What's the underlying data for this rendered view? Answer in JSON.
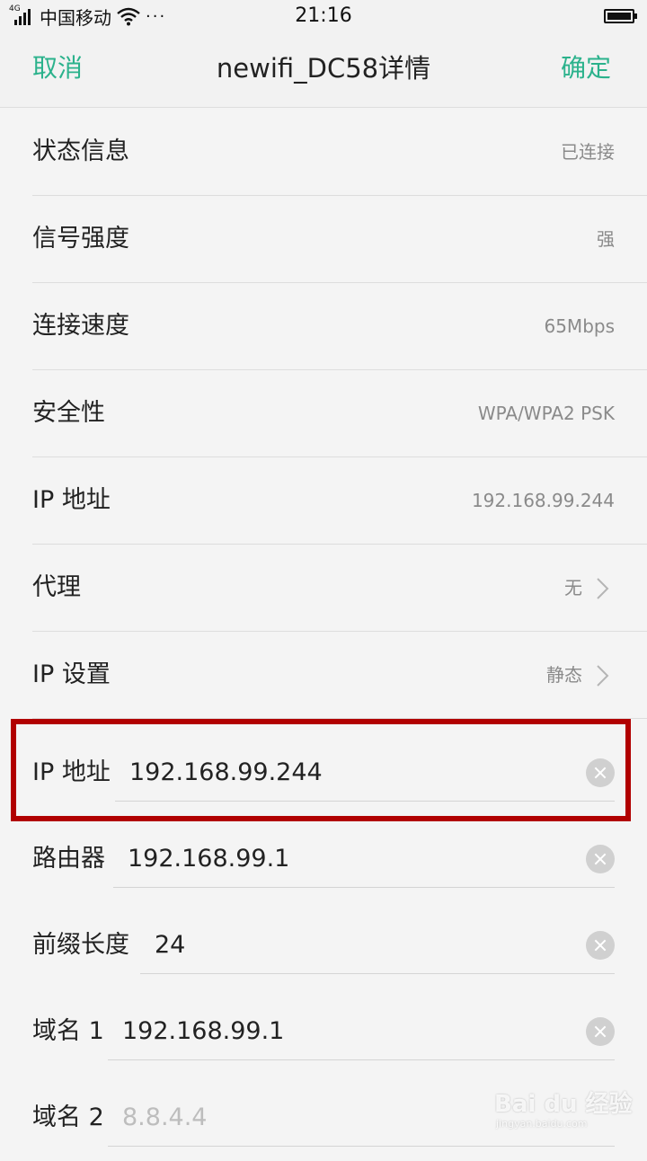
{
  "status_bar": {
    "network_type": "4G",
    "carrier": "中国移动",
    "overflow": "···",
    "time": "21:16"
  },
  "header": {
    "cancel_label": "取消",
    "title": "newifi_DC58详情",
    "confirm_label": "确定"
  },
  "info_rows": [
    {
      "label": "状态信息",
      "value": "已连接"
    },
    {
      "label": "信号强度",
      "value": "强"
    },
    {
      "label": "连接速度",
      "value": "65Mbps"
    },
    {
      "label": "安全性",
      "value": "WPA/WPA2 PSK"
    },
    {
      "label": "IP 地址",
      "value": "192.168.99.244"
    },
    {
      "label": "代理",
      "value": "无"
    },
    {
      "label": "IP 设置",
      "value": "静态"
    }
  ],
  "input_rows": [
    {
      "label": "IP 地址",
      "value": "192.168.99.244"
    },
    {
      "label": "路由器",
      "value": "192.168.99.1"
    },
    {
      "label": "前缀长度",
      "value": "24"
    },
    {
      "label": "域名 1",
      "value": "192.168.99.1"
    },
    {
      "label": "域名 2",
      "placeholder": "8.8.4.4"
    }
  ],
  "watermark": {
    "main": "Bai du 经验",
    "sub": "jingyan.baidu.com"
  },
  "colors": {
    "accent": "#2bb28c",
    "highlight": "#b10000",
    "background": "#f4f4f4"
  }
}
